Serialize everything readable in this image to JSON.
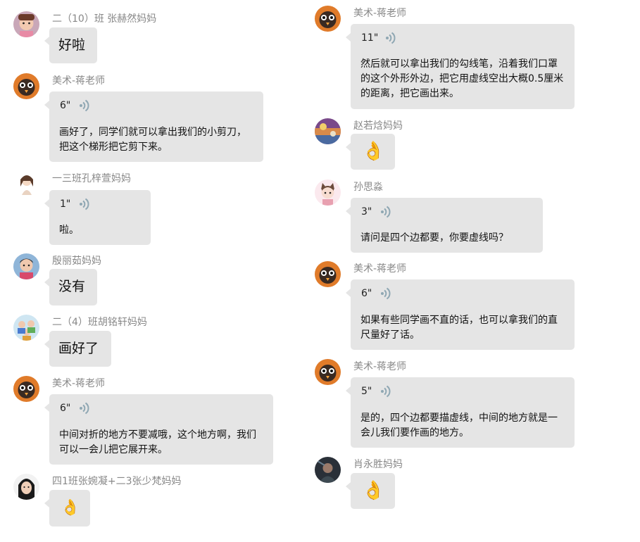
{
  "colors": {
    "bubble": "#e5e5e5",
    "name": "#888888",
    "wave": "#8fa7b3"
  },
  "left_column": [
    {
      "name": "二（10）班 张赫然妈妈",
      "kind": "text",
      "text": "好啦",
      "avatar": "child-photo-avatar"
    },
    {
      "name": "美术-蒋老师",
      "kind": "voice",
      "duration": "6\"",
      "transcript": "画好了，同学们就可以拿出我们的小剪刀，把这个梯形把它剪下来。",
      "avatar": "owl-cartoon-avatar"
    },
    {
      "name": "一三班孔梓萱妈妈",
      "kind": "voice",
      "duration": "1\"",
      "transcript": "啦。",
      "avatar": "anime-girl-avatar"
    },
    {
      "name": "殷丽茹妈妈",
      "kind": "text",
      "text": "没有",
      "avatar": "child-photo-avatar"
    },
    {
      "name": "二（4）班胡铭轩妈妈",
      "kind": "text",
      "text": "画好了",
      "avatar": "family-photo-avatar"
    },
    {
      "name": "美术-蒋老师",
      "kind": "voice",
      "duration": "6\"",
      "transcript": "中间对折的地方不要减哦，这个地方啊，我们可以一会儿把它展开来。",
      "avatar": "owl-cartoon-avatar"
    },
    {
      "name": "四1班张婉凝+二3张少梵妈妈",
      "kind": "emoji",
      "emoji": "👌",
      "avatar": "woman-photo-avatar"
    }
  ],
  "right_column": [
    {
      "name": "美术-蒋老师",
      "kind": "voice",
      "duration": "11\"",
      "transcript": "然后就可以拿出我们的勾线笔，沿着我们口罩的这个外形外边，把它用虚线空出大概0.5厘米的距离，把它画出来。",
      "avatar": "owl-cartoon-avatar"
    },
    {
      "name": "赵若焓妈妈",
      "kind": "emoji",
      "emoji": "👌",
      "avatar": "painting-avatar"
    },
    {
      "name": "孙思淼",
      "kind": "voice",
      "duration": "3\"",
      "transcript": "请问是四个边都要，你要虚线吗？",
      "avatar": "cat-cartoon-avatar"
    },
    {
      "name": "美术-蒋老师",
      "kind": "voice",
      "duration": "6\"",
      "transcript": "如果有些同学画不直的话，也可以拿我们的直尺量好了话。",
      "avatar": "owl-cartoon-avatar"
    },
    {
      "name": "美术-蒋老师",
      "kind": "voice",
      "duration": "5\"",
      "transcript": "是的，四个边都要描虚线，中间的地方就是一会儿我们要作画的地方。",
      "avatar": "owl-cartoon-avatar"
    },
    {
      "name": "肖永胜妈妈",
      "kind": "emoji",
      "emoji": "👌",
      "avatar": "dark-photo-avatar"
    }
  ]
}
